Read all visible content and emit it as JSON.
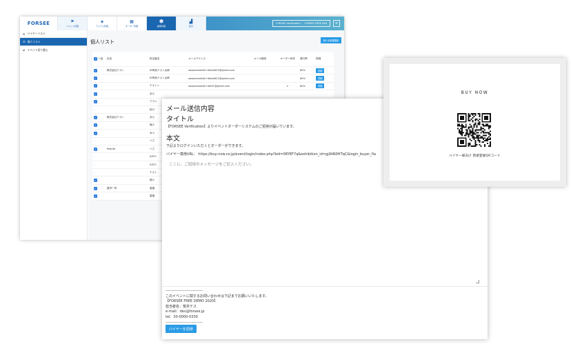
{
  "app": {
    "logo": "FORSEE",
    "nav_tabs": [
      {
        "label": "イベント管理",
        "icon": "flag-icon"
      },
      {
        "label": "アイテム管理",
        "icon": "tag-icon"
      },
      {
        "label": "オーダー管理",
        "icon": "calendar-icon"
      },
      {
        "label": "顧客管理",
        "icon": "users-icon"
      },
      {
        "label": "集計",
        "icon": "chart-icon"
      }
    ],
    "active_tab": "顧客管理",
    "account": "FORSEE Verification ｜ FORSEE FREE DE▾"
  },
  "sidebar": {
    "title": "バイヤーリスト",
    "items": [
      {
        "label": "個人リスト",
        "active": true
      },
      {
        "label": "イベント切り替え",
        "active": false
      }
    ]
  },
  "main": {
    "page_title": "個人リスト",
    "new_button": "個人を新規登録",
    "columns": [
      "一括",
      "社名",
      "担当者名",
      "メールアドレス",
      "メール既読",
      "オーダー状況",
      "進行率",
      "詳細"
    ],
    "detail_label": "詳細",
    "rows": [
      {
        "checked": true,
        "company": "株式会社テスト",
        "name": "ID有効テスト太郎",
        "email": "sasanomobile+idtest002@gmail.com",
        "read": "",
        "ordered": "",
        "rate": "80%",
        "detail": true
      },
      {
        "checked": true,
        "company": "",
        "name": "ID有効テスト太郎",
        "email": "sasanomobile+idtest001@gmail.com",
        "read": "",
        "ordered": "",
        "rate": "80%",
        "detail": true
      },
      {
        "checked": true,
        "company": "",
        "name": "テストン",
        "email": "sasanomobile+id001@gmail.com",
        "read": "",
        "ordered": "✔",
        "rate": "80%",
        "detail": true
      },
      {
        "checked": true,
        "company": "",
        "name": "あら",
        "email": "",
        "read": "",
        "ordered": "",
        "rate": "",
        "detail": false
      },
      {
        "checked": true,
        "company": "",
        "name": "アライ",
        "email": "",
        "read": "",
        "ordered": "",
        "rate": "",
        "detail": false
      },
      {
        "checked": false,
        "company": "",
        "name": "抜け",
        "email": "",
        "read": "",
        "ordered": "",
        "rate": "",
        "detail": false
      },
      {
        "checked": true,
        "company": "株式会社テスト",
        "name": "あら",
        "email": "",
        "read": "",
        "ordered": "",
        "rate": "",
        "detail": false
      },
      {
        "checked": true,
        "company": "",
        "name": "個人",
        "email": "",
        "read": "",
        "ordered": "",
        "rate": "",
        "detail": false
      },
      {
        "checked": true,
        "company": "",
        "name": "みう",
        "email": "",
        "read": "",
        "ordered": "",
        "rate": "",
        "detail": false
      },
      {
        "checked": false,
        "company": "",
        "name": "ツさ",
        "email": "",
        "read": "",
        "ordered": "",
        "rate": "",
        "detail": false
      },
      {
        "checked": true,
        "company": "fowufe",
        "name": "ツさ",
        "email": "",
        "read": "",
        "ordered": "",
        "rate": "",
        "detail": false
      },
      {
        "checked": false,
        "company": "",
        "name": "SATO",
        "email": "",
        "read": "",
        "ordered": "",
        "rate": "",
        "detail": false
      },
      {
        "checked": false,
        "company": "",
        "name": "SATO",
        "email": "",
        "read": "",
        "ordered": "",
        "rate": "",
        "detail": false
      },
      {
        "checked": false,
        "company": "",
        "name": "テスト",
        "email": "",
        "read": "",
        "ordered": "",
        "rate": "",
        "detail": false
      },
      {
        "checked": true,
        "company": "",
        "name": "個人",
        "email": "",
        "read": "",
        "ordered": "",
        "rate": "",
        "detail": false
      },
      {
        "checked": true,
        "company": "直号一号",
        "name": "高橋",
        "email": "",
        "read": "",
        "ordered": "",
        "rate": "",
        "detail": false
      },
      {
        "checked": true,
        "company": "",
        "name": "高橋",
        "email": "",
        "read": "",
        "ordered": "",
        "rate": "",
        "detail": false
      }
    ]
  },
  "mail": {
    "heading": "メール送信内容",
    "title_label": "タイトル",
    "title_text": "【FORSEE Verification】よりイベントオーダーシステムのご招待が届いています。",
    "body_label": "本文",
    "body_line1": "下記よりログインいただくとオーダーができます。",
    "body_line2": "バイヤー専用URL： https://buy-now.co.jp/event/login/index.php?bid=0RYEF7q&exhibition_id=gjIAiN0HTqC&login_buyer_fla",
    "placeholder": "ここに、ご招待のメッセージをご記入ください。",
    "footer": "------------------------------\nこのイベントに関するお問い合わせは下記までお願いいたします。\n【FORSEE FREE DEMO 2020】\n担当者名：荒井テス\ne-mail：dev@forsee.jp\ntel：30-0000-0330\n------------------------------",
    "invite_button": "バイヤーを招待"
  },
  "qr": {
    "brand": "BUY NOW",
    "caption": "バイヤー様向け 新規登録QRコード"
  }
}
